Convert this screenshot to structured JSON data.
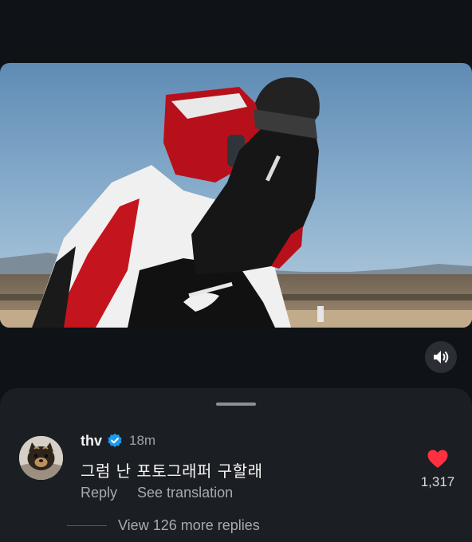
{
  "video": {
    "sound_icon": "speaker-icon"
  },
  "sheet": {
    "comment": {
      "username": "thv",
      "verified_icon": "verified-badge-icon",
      "time": "18m",
      "text": "그럼 난 포토그래퍼 구할래",
      "reply_label": "Reply",
      "translate_label": "See translation",
      "like_icon": "heart-icon",
      "like_color": "#ff3040",
      "like_count": "1,317"
    },
    "view_replies_label": "View 126 more replies"
  },
  "colors": {
    "background": "#0f1216",
    "sheet": "#1b1e22",
    "verified": "#1d9bf0"
  }
}
